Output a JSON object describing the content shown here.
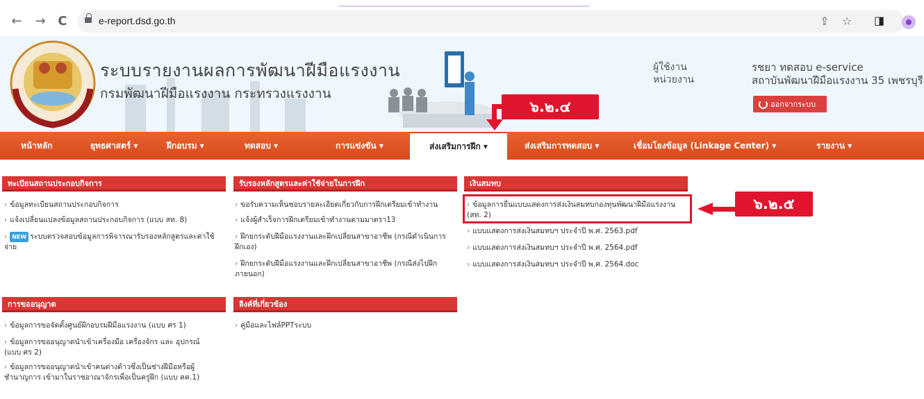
{
  "browser": {
    "url": "e-report.dsd.go.th",
    "back_glyph": "←",
    "forward_glyph": "→",
    "reload_glyph": "C",
    "share_glyph": "⇪",
    "star_glyph": "☆",
    "sidepanel_glyph": "◨"
  },
  "header": {
    "title": "ระบบรายงานผลการพัฒนาฝีมือแรงงาน",
    "subtitle": "กรมพัฒนาฝีมือแรงงาน กระทรวงแรงงาน",
    "user_label": "ผู้ใช้งาน",
    "unit_label": "หน่วยงาน",
    "user_value": "รชยา ทดสอบ e-service",
    "unit_value": "สถาบันพัฒนาฝีมือแรงงาน 35 เพชรบุรี",
    "logout_label": "ออกจากระบบ"
  },
  "callouts": {
    "menu_callout": "๖.๒.๔",
    "item_callout": "๖.๒.๕"
  },
  "menu": {
    "items": [
      {
        "label": "หน้าหลัก"
      },
      {
        "label": "ยุทธศาสตร์ ▾"
      },
      {
        "label": "ฝึกอบรม ▾"
      },
      {
        "label": "ทดสอบ ▾"
      },
      {
        "label": "การแข่งขัน ▾"
      },
      {
        "label": "ส่งเสริมการฝึก ▾"
      },
      {
        "label": "ส่งเสริมการทดสอบ ▾"
      },
      {
        "label": "เชื่อมโยงข้อมูล (Linkage Center) ▾"
      },
      {
        "label": "รายงาน ▾"
      }
    ]
  },
  "panels": {
    "reg": {
      "title": "ทะเบียนสถานประกอบกิจการ",
      "items": [
        "ข้อมูลทะเบียนสถานประกอบกิจการ",
        "แจ้งเปลี่ยนแปลงข้อมูลสถานประกอบกิจการ (แบบ สท. 8)",
        "ระบบตรวจสอบข้อมูลการพิจารณารับรองหลักสูตรและค่าใช้จ่าย"
      ],
      "new_badge": "NEW"
    },
    "cert": {
      "title": "รับรองหลักสูตรและค่าใช้จ่ายในการฝึก",
      "items": [
        "ขอรับความเห็นชอบรายละเอียดเกี่ยวกับการฝึกเตรียมเข้าทำงาน",
        "แจ้งผู้สำเร็จการฝึกเตรียมเข้าทำงานตามมาตรา13",
        "ฝึกยกระดับฝีมือแรงงานและฝึกเปลี่ยนสาขาอาชีพ (กรณีดำเนินการฝึกเอง)",
        "ฝึกยกระดับฝีมือแรงงานและฝึกเปลี่ยนสาขาอาชีพ (กรณีส่งไปฝึกภายนอก)"
      ]
    },
    "fund": {
      "title": "เงินสมทบ",
      "items": [
        "ข้อมูลการยื่นแบบแสดงการส่งเงินสมทบกองทุนพัฒนาฝีมือแรงงาน (สท. 2)",
        "แบบแสดงการส่งเงินสมทบฯ ประจำปี พ.ศ. 2563.pdf",
        "แบบแสดงการส่งเงินสมทบฯ ประจำปี พ.ศ. 2564.pdf",
        "แบบแสดงการส่งเงินสมทบฯ ประจำปี พ.ศ. 2564.doc"
      ]
    },
    "license": {
      "title": "การขออนุญาต",
      "items": [
        "ข้อมูลการขอจัดตั้งศูนย์ฝึกอบรมฝีมือแรงงาน (แบบ ศร 1)",
        "ข้อมูลการขออนุญาตนำเข้าเครื่องมือ เครื่องจักร และ อุปกรณ์ (แบบ ศร 2)",
        "ข้อมูลการขออนุญาตนำเข้าคนต่างด้าวซึ่งเป็นช่างฝีมือหรือผู้ชำนาญการ เข้ามาในราชอาณาจักรเพื่อเป็นครูฝึก (แบบ คค.1)"
      ]
    },
    "links": {
      "title": "ลิงค์ที่เกี่ยวข้อง",
      "items": [
        "คู่มือและไฟล์PPTระบบ"
      ]
    }
  },
  "colors": {
    "menu_bar": "#d84a1f",
    "panel_head": "#d93636",
    "callout": "#e0152d",
    "banner_bg": "#eef7fd"
  }
}
